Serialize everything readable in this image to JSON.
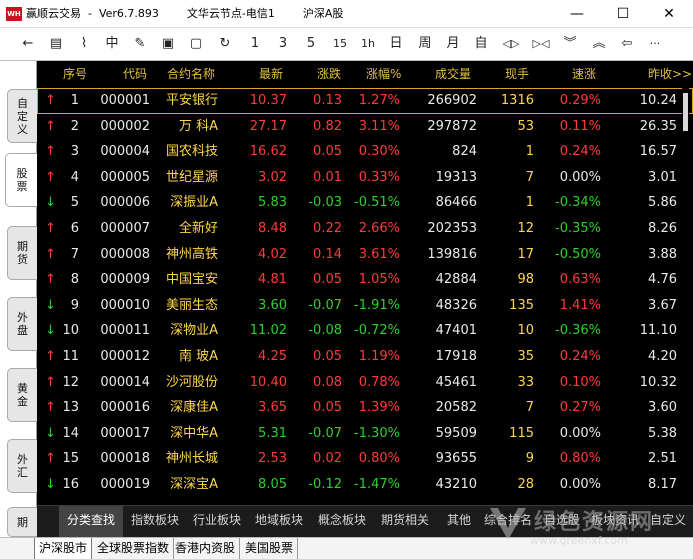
{
  "window": {
    "app_name": "赢顺云交易",
    "version": "Ver6.7.893",
    "server": "文华云节点-电信1",
    "market_title": "沪深A股",
    "min_icon": "minimize-icon",
    "max_icon": "maximize-icon",
    "close_icon": "close-icon"
  },
  "toolbar": {
    "items": [
      {
        "name": "back-arrow-icon",
        "glyph": "←"
      },
      {
        "name": "quote-list-icon",
        "glyph": "▤"
      },
      {
        "name": "line-chart-icon",
        "glyph": "⌇"
      },
      {
        "name": "kline-icon",
        "glyph": "中"
      },
      {
        "name": "draw-icon",
        "glyph": "✎"
      },
      {
        "name": "f10-icon",
        "glyph": "▣"
      },
      {
        "name": "save-icon",
        "glyph": "▢"
      },
      {
        "name": "refresh-icon",
        "glyph": "↻"
      },
      {
        "name": "period-1",
        "glyph": "1"
      },
      {
        "name": "period-3",
        "glyph": "3"
      },
      {
        "name": "period-5",
        "glyph": "5"
      },
      {
        "name": "period-15",
        "glyph": "15"
      },
      {
        "name": "period-1h",
        "glyph": "1h"
      },
      {
        "name": "period-day",
        "glyph": "日"
      },
      {
        "name": "period-week",
        "glyph": "周"
      },
      {
        "name": "period-month",
        "glyph": "月"
      },
      {
        "name": "period-custom",
        "glyph": "自"
      },
      {
        "name": "zoom-in-icon",
        "glyph": "◁▷"
      },
      {
        "name": "zoom-out-icon",
        "glyph": "▷◁"
      },
      {
        "name": "page-down-icon",
        "glyph": "︾"
      },
      {
        "name": "page-up-icon",
        "glyph": "︽"
      },
      {
        "name": "left-icon",
        "glyph": "⇦"
      },
      {
        "name": "more-icon",
        "glyph": "···"
      }
    ]
  },
  "left_tabs": [
    "自定义",
    "股票",
    "期货",
    "外盘",
    "黄金",
    "外汇",
    "期"
  ],
  "table": {
    "headers": [
      "序号",
      "代码",
      "合约名称",
      "最新",
      "涨跌",
      "涨幅%",
      "成交量",
      "现手",
      "速涨",
      "昨收>>"
    ],
    "rows": [
      {
        "dir": "up",
        "no": "1",
        "code": "000001",
        "name": "平安银行",
        "last": "10.37",
        "chg": "0.13",
        "pct": "1.27%",
        "vol": "266902",
        "hand": "1316",
        "speed": "0.29%",
        "prev": "10.24"
      },
      {
        "dir": "up",
        "no": "2",
        "code": "000002",
        "name": "万 科A",
        "last": "27.17",
        "chg": "0.82",
        "pct": "3.11%",
        "vol": "297872",
        "hand": "53",
        "speed": "0.11%",
        "prev": "26.35"
      },
      {
        "dir": "up",
        "no": "3",
        "code": "000004",
        "name": "国农科技",
        "last": "16.62",
        "chg": "0.05",
        "pct": "0.30%",
        "vol": "824",
        "hand": "1",
        "speed": "0.24%",
        "prev": "16.57"
      },
      {
        "dir": "up",
        "no": "4",
        "code": "000005",
        "name": "世纪星源",
        "last": "3.02",
        "chg": "0.01",
        "pct": "0.33%",
        "vol": "19313",
        "hand": "7",
        "speed": "0.00%",
        "prev": "3.01"
      },
      {
        "dir": "dn",
        "no": "5",
        "code": "000006",
        "name": "深振业A",
        "last": "5.83",
        "chg": "-0.03",
        "pct": "-0.51%",
        "vol": "86466",
        "hand": "1",
        "speed": "-0.34%",
        "prev": "5.86"
      },
      {
        "dir": "up",
        "no": "6",
        "code": "000007",
        "name": "全新好",
        "last": "8.48",
        "chg": "0.22",
        "pct": "2.66%",
        "vol": "202353",
        "hand": "12",
        "speed": "-0.35%",
        "prev": "8.26"
      },
      {
        "dir": "up",
        "no": "7",
        "code": "000008",
        "name": "神州高铁",
        "last": "4.02",
        "chg": "0.14",
        "pct": "3.61%",
        "vol": "139816",
        "hand": "17",
        "speed": "-0.50%",
        "prev": "3.88"
      },
      {
        "dir": "up",
        "no": "8",
        "code": "000009",
        "name": "中国宝安",
        "last": "4.81",
        "chg": "0.05",
        "pct": "1.05%",
        "vol": "42884",
        "hand": "98",
        "speed": "0.63%",
        "prev": "4.76"
      },
      {
        "dir": "dn",
        "no": "9",
        "code": "000010",
        "name": "美丽生态",
        "last": "3.60",
        "chg": "-0.07",
        "pct": "-1.91%",
        "vol": "48326",
        "hand": "135",
        "speed": "1.41%",
        "prev": "3.67"
      },
      {
        "dir": "dn",
        "no": "10",
        "code": "000011",
        "name": "深物业A",
        "last": "11.02",
        "chg": "-0.08",
        "pct": "-0.72%",
        "vol": "47401",
        "hand": "10",
        "speed": "-0.36%",
        "prev": "11.10"
      },
      {
        "dir": "up",
        "no": "11",
        "code": "000012",
        "name": "南 玻A",
        "last": "4.25",
        "chg": "0.05",
        "pct": "1.19%",
        "vol": "17918",
        "hand": "35",
        "speed": "0.24%",
        "prev": "4.20"
      },
      {
        "dir": "up",
        "no": "12",
        "code": "000014",
        "name": "沙河股份",
        "last": "10.40",
        "chg": "0.08",
        "pct": "0.78%",
        "vol": "45461",
        "hand": "33",
        "speed": "0.10%",
        "prev": "10.32"
      },
      {
        "dir": "up",
        "no": "13",
        "code": "000016",
        "name": "深康佳A",
        "last": "3.65",
        "chg": "0.05",
        "pct": "1.39%",
        "vol": "20582",
        "hand": "7",
        "speed": "0.27%",
        "prev": "3.60"
      },
      {
        "dir": "dn",
        "no": "14",
        "code": "000017",
        "name": "深中华A",
        "last": "5.31",
        "chg": "-0.07",
        "pct": "-1.30%",
        "vol": "59509",
        "hand": "115",
        "speed": "0.00%",
        "prev": "5.38"
      },
      {
        "dir": "up",
        "no": "15",
        "code": "000018",
        "name": "神州长城",
        "last": "2.53",
        "chg": "0.02",
        "pct": "0.80%",
        "vol": "93655",
        "hand": "9",
        "speed": "0.80%",
        "prev": "2.51"
      },
      {
        "dir": "dn",
        "no": "16",
        "code": "000019",
        "name": "深深宝A",
        "last": "8.05",
        "chg": "-0.12",
        "pct": "-1.47%",
        "vol": "43210",
        "hand": "28",
        "speed": "0.00%",
        "prev": "8.17"
      }
    ]
  },
  "sub_tabs": [
    "分类查找",
    "指数板块",
    "行业板块",
    "地域板块",
    "概念板块",
    "期货相关",
    "其他",
    "综合排名",
    "自选股",
    "板块资讯",
    "自定义"
  ],
  "market_tabs": [
    "沪深股市",
    "全球股票指数",
    "香港内资股",
    "美国股票"
  ],
  "watermark": {
    "text": "绿色资源网",
    "url": "www.greenxf.com",
    "badge": "论文提样"
  },
  "colors": {
    "up": "#ff3b3b",
    "down": "#2ed02e",
    "header": "#e0c040",
    "background": "#000000"
  }
}
